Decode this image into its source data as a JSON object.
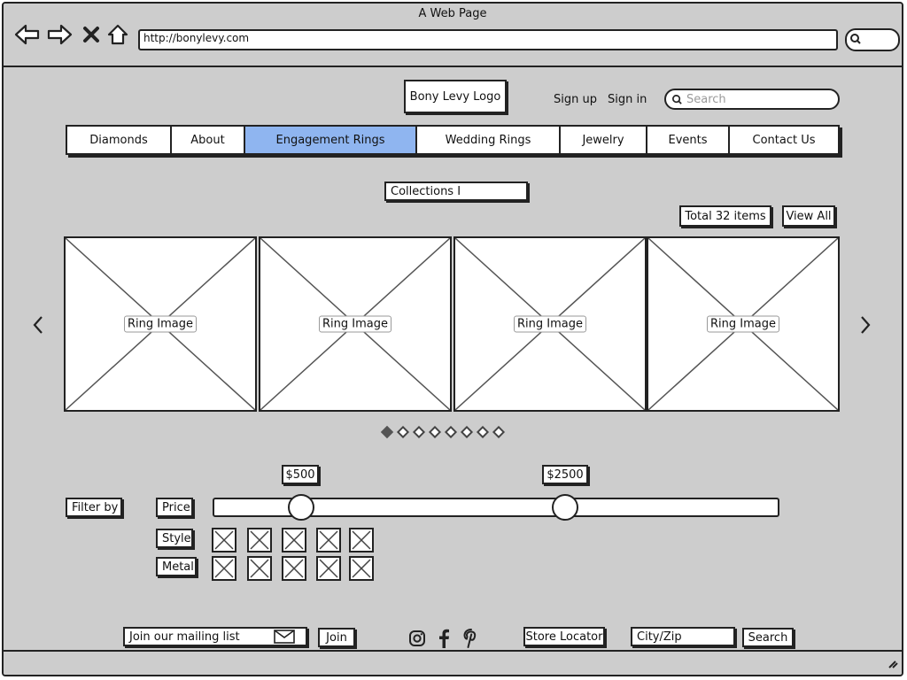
{
  "window": {
    "title": "A Web Page",
    "url": "http://bonylevy.com"
  },
  "header": {
    "logo": "Bony Levy Logo",
    "signup": "Sign up",
    "signin": "Sign in",
    "search_placeholder": "Search"
  },
  "nav": {
    "items": [
      "Diamonds",
      "About",
      "Engagement Rings",
      "Wedding Rings",
      "Jewelry",
      "Events",
      "Contact Us"
    ],
    "active": "Engagement Rings"
  },
  "collection": {
    "selected": "Collections I",
    "total": "Total 32 items",
    "view_all": "View All"
  },
  "carousel": {
    "items": [
      "Ring Image",
      "Ring Image",
      "Ring Image",
      "Ring Image"
    ],
    "page_count": 8,
    "active_page": 1
  },
  "filter": {
    "label": "Filter by",
    "price_label": "Price",
    "price_min": "$500",
    "price_max": "$2500",
    "style_label": "Style",
    "metal_label": "Metal"
  },
  "footer": {
    "mailing": "Join our mailing list",
    "join": "Join",
    "store_locator": "Store Locator",
    "city_zip": "City/Zip",
    "search": "Search"
  },
  "icons": {
    "back": "arrow-left-icon",
    "forward": "arrow-right-icon",
    "stop": "close-icon",
    "home": "home-icon",
    "instagram": "instagram-icon",
    "facebook": "facebook-icon",
    "pinterest": "pinterest-icon",
    "mail": "envelope-icon"
  },
  "colors": {
    "active_tab": "#8fb5f0",
    "frame": "#cdcdcd"
  }
}
